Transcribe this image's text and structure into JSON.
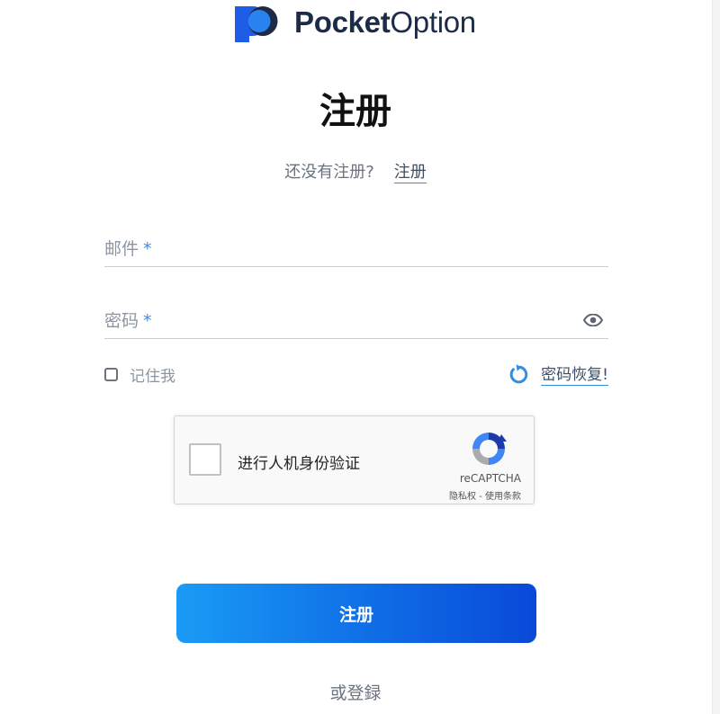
{
  "brand": {
    "name_bold": "Pocket",
    "name_light": "Option",
    "colors": {
      "logo_blue": "#1f5ce8",
      "logo_dark": "#1c2c48"
    }
  },
  "page": {
    "title": "注册",
    "subtitle_text": "还没有注册?",
    "subtitle_link": "注册"
  },
  "form": {
    "email": {
      "label": "邮件",
      "required_mark": "*",
      "value": ""
    },
    "password": {
      "label": "密码",
      "required_mark": "*",
      "value": "",
      "toggle_icon": "eye-icon"
    },
    "remember_label": "记住我",
    "remember_checked": false,
    "recover_label": "密码恢复!",
    "recover_icon": "refresh-icon"
  },
  "captcha": {
    "label": "进行人机身份验证",
    "brand": "reCAPTCHA",
    "links": "隐私权 - 使用条款"
  },
  "submit_label": "注册",
  "alt_action": "或登録",
  "colors": {
    "accent": "#2f8fe5",
    "button_gradient_start": "#1a9bf5",
    "button_gradient_end": "#0a49d8",
    "muted_text": "#8c96a3"
  }
}
